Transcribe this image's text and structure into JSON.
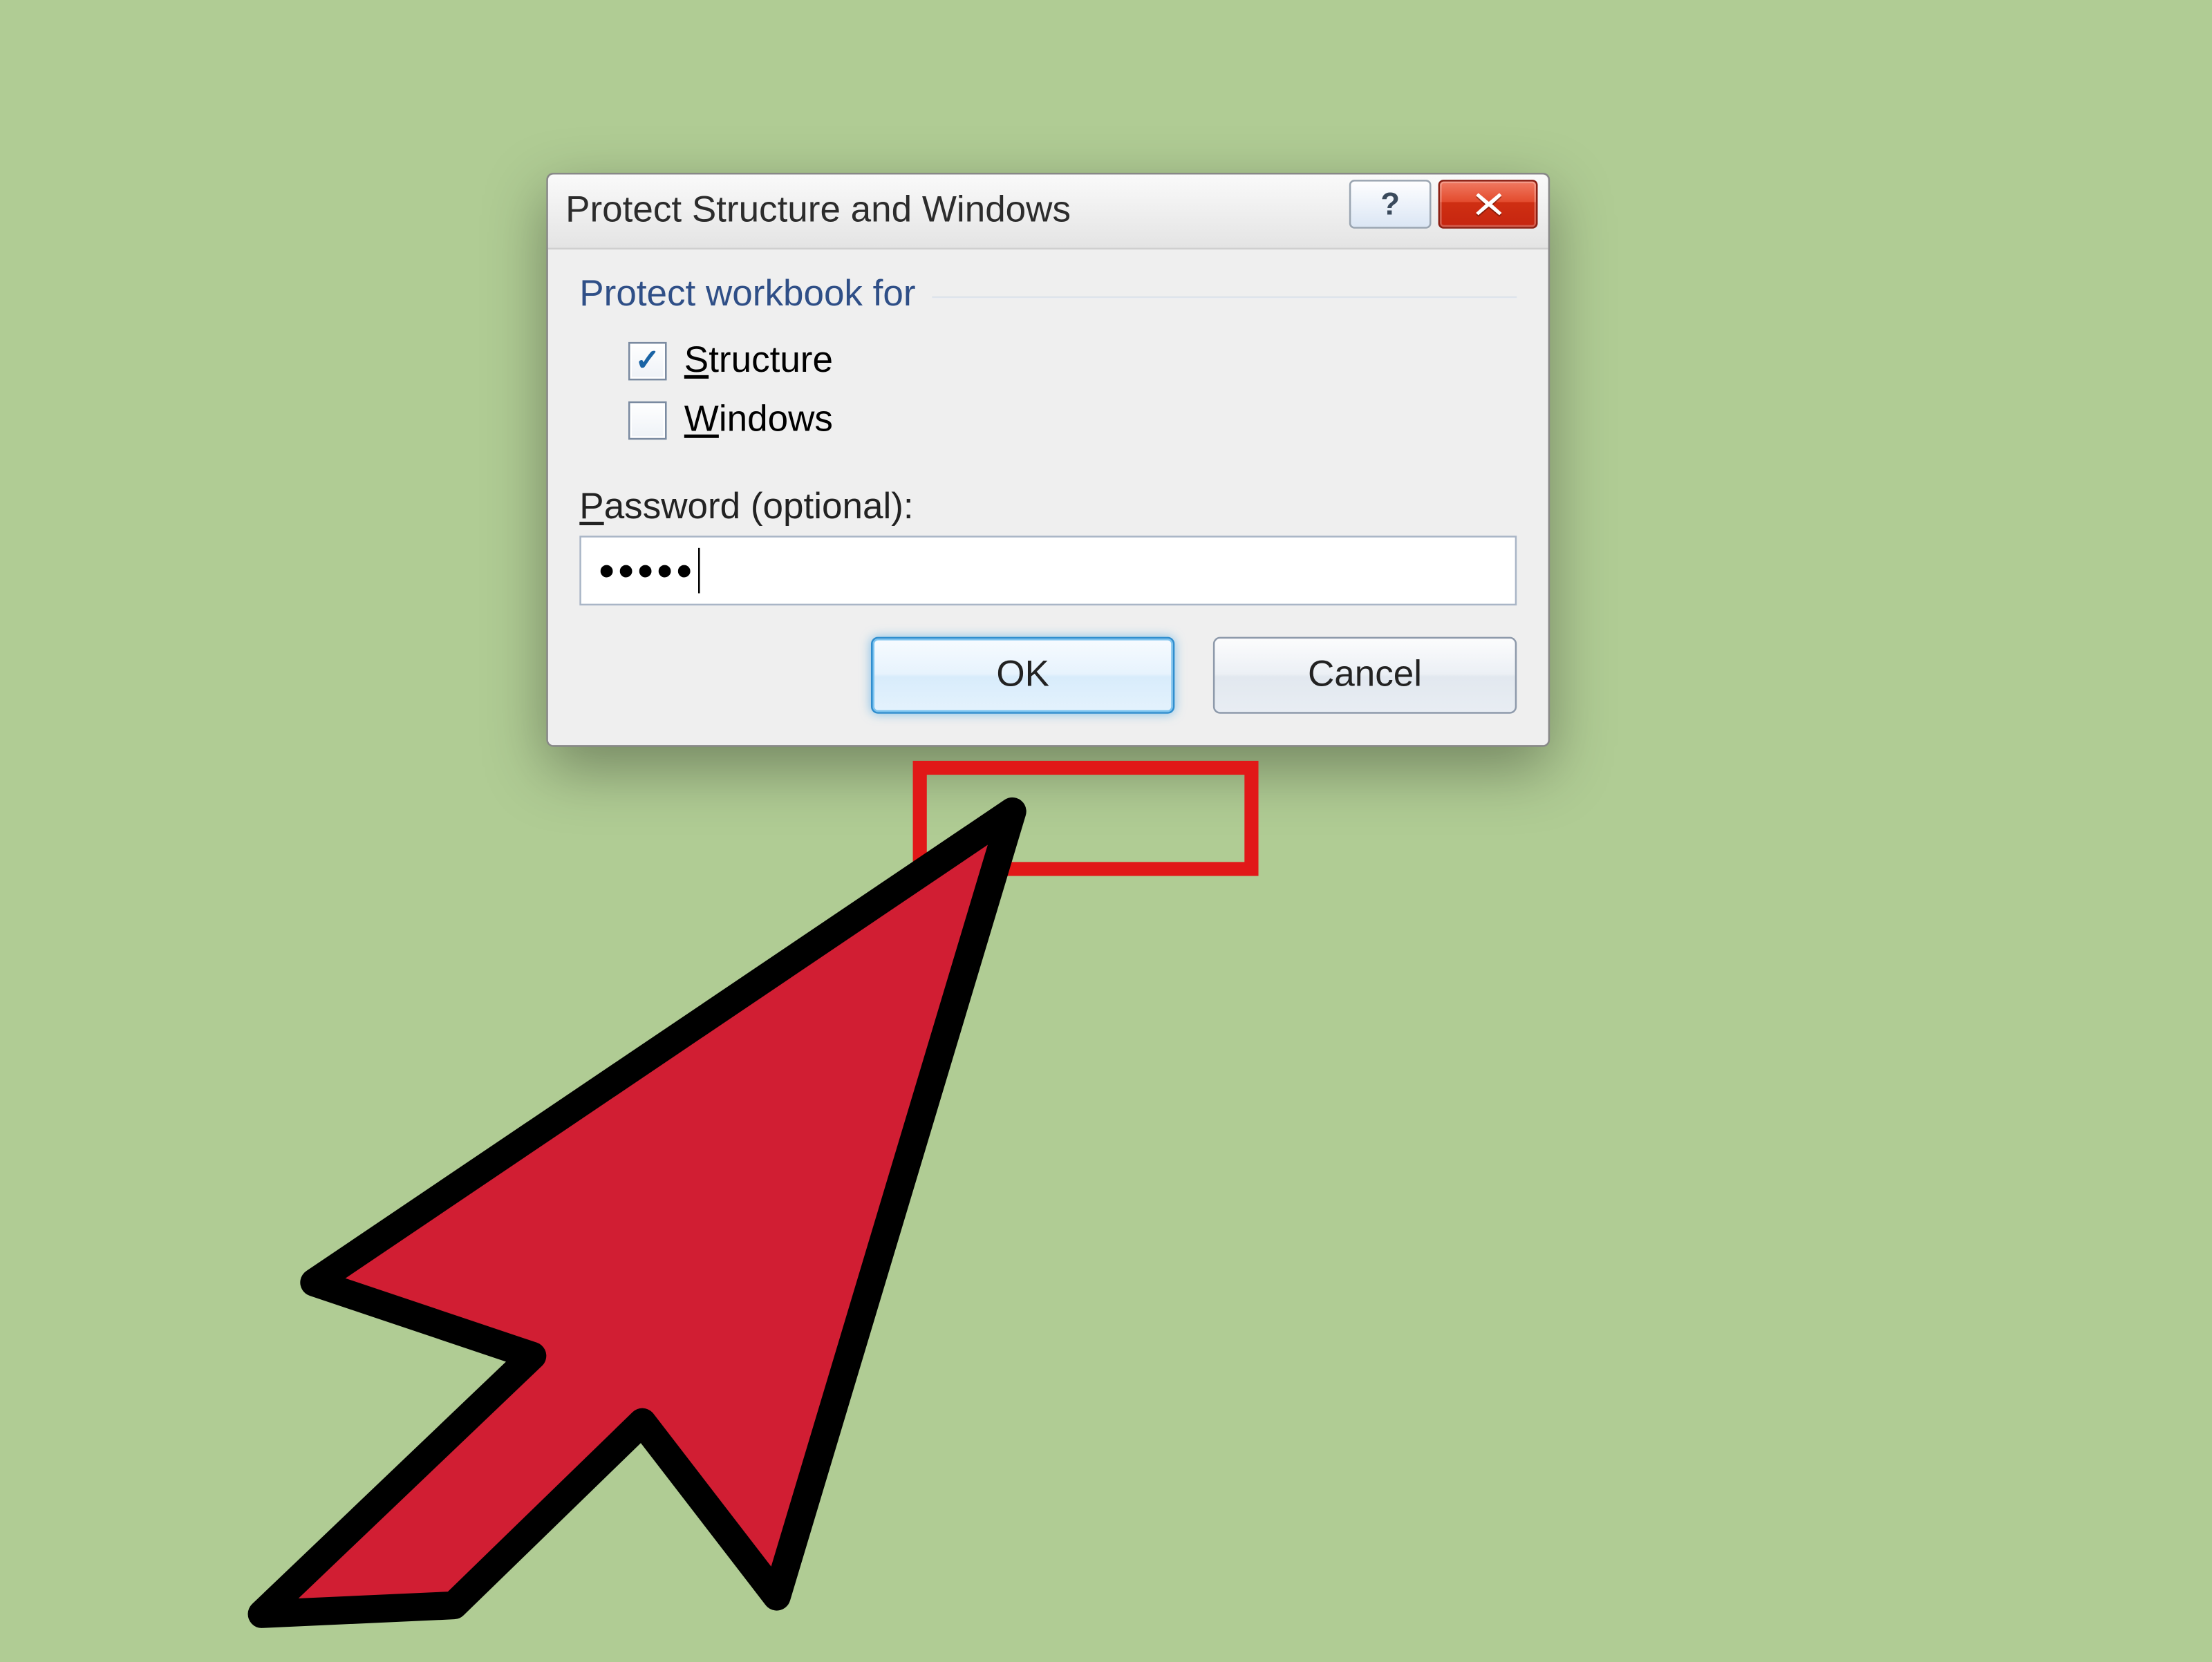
{
  "dialog": {
    "title": "Protect Structure and Windows",
    "group_label": "Protect workbook for",
    "checkboxes": {
      "structure": {
        "label_pre": "",
        "mn": "S",
        "rest": "tructure",
        "checked": true
      },
      "windows": {
        "label_pre": "",
        "mn": "W",
        "rest": "indows",
        "checked": false
      }
    },
    "password_label": {
      "mn": "P",
      "rest": "assword (optional):"
    },
    "password_value": "•••••",
    "buttons": {
      "ok": "OK",
      "cancel": "Cancel"
    }
  },
  "titlebar_controls": {
    "help_glyph": "?",
    "close_glyph": "x"
  }
}
